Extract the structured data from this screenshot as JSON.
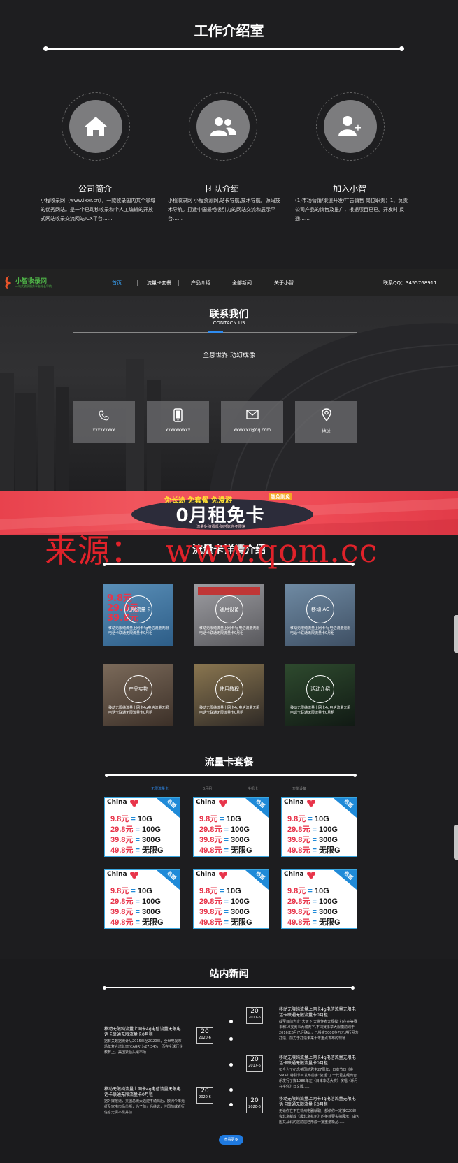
{
  "intro": {
    "title": "工作介绍室",
    "features": [
      {
        "icon": "home-icon",
        "title": "公司简介",
        "desc": "小程收录网（www.ixxr.cn），一款收录国内共个领域的优秀网站。是一个已动秒收录和个人工编辑的开放式网站收录交流网站ICX平台……"
      },
      {
        "icon": "team-icon",
        "title": "团队介绍",
        "desc": "小程收录网 小程资源网,站长导航,技术导航。源码技术导航。打造中国最畅吸引力的网站交流和展示平台……"
      },
      {
        "icon": "add-user-icon",
        "title": "加入小智",
        "desc": "(1)市场营销/渠道开发/广告销售 岗位职责：1、负责公司产品的销售及推广，根据项目已已。开发时 反通……"
      }
    ]
  },
  "nav": {
    "logo_text": "小智收录网",
    "logo_sub": "一站式收录服务平台站长导航",
    "items": [
      "首页",
      "流量卡套餐",
      "产品介绍",
      "全部新闻",
      "关于小智"
    ],
    "contact": "联系QQ：3455768911"
  },
  "contact": {
    "title": "联系我们",
    "subtitle": "CONTACN US",
    "tagline": "全息世界 动幻成像",
    "boxes": [
      {
        "icon": "phone-icon",
        "text": "xxxxxxxxx"
      },
      {
        "icon": "mobile-icon",
        "text": "xxxxxxxxxx"
      },
      {
        "icon": "mail-icon",
        "text": "xxxxxxx@qq.com"
      },
      {
        "icon": "location-icon",
        "text": "地球"
      }
    ]
  },
  "banner": {
    "top_text": "免长途 免套餐 免漫游",
    "right_tag": "能免则免",
    "main_text": "0月租免卡",
    "sub_text": "流量多·资费低·随时随地·不限速"
  },
  "watermark": "来源：  www.qom.cc",
  "detail": {
    "title": "流量卡详情介绍",
    "tiles": [
      {
        "label": "无限流量卡",
        "caption": "移动无限纯流量上网卡4g电信流量无限电话卡联通无限流量卡0月租"
      },
      {
        "label": "通用设备",
        "caption": "移动无限纯流量上网卡4g电信流量无限电话卡联通无限流量卡0月租"
      },
      {
        "label": "移动 AC",
        "caption": "移动无限纯流量上网卡4g电信流量无限电话卡联通无限流量卡0月租"
      },
      {
        "label": "产品实物",
        "caption": "移动无限纯流量上网卡4g电信流量无限电话卡联通无限流量卡0月租"
      },
      {
        "label": "使用教程",
        "caption": "移动无限纯流量上网卡4g电信流量无限电话卡联通无限流量卡0月租"
      },
      {
        "label": "活动介绍",
        "caption": "移动无限纯流量上网卡4g电信流量无限电话卡联通无限流量卡0月租"
      }
    ]
  },
  "packages": {
    "title": "流量卡套餐",
    "tabs": [
      "无限流量卡",
      "0月租",
      "手机卡",
      "万能设备"
    ],
    "card": {
      "brand": "China",
      "badge": "热销",
      "rows": [
        {
          "price": "9.8元",
          "eq": "=",
          "amount": "10G"
        },
        {
          "price": "29.8元",
          "eq": "=",
          "amount": "100G"
        },
        {
          "price": "39.8元",
          "eq": "=",
          "amount": "300G"
        },
        {
          "price": "49.8元",
          "eq": "=",
          "amount": "无限G"
        }
      ]
    }
  },
  "news": {
    "title": "站内新闻",
    "left": [
      {
        "title": "移动无限纯流量上网卡4g电信流量无限电话卡联通无限流量卡0月租",
        "desc": "据有关数据统计从2015年至2020年，全世电视市场年复合增长率(CAGR)为27.34%，而在全球行业教育上，美国紧后头绪市场……",
        "day": "20",
        "year": "2020-6"
      },
      {
        "title": "移动无限纯流量上网卡4g电信流量无限电话卡联通无限流量卡0月租",
        "desc": "据外媒报道，美国总统大选迎不确局后，欧洲今年光纤及家电市场份额，为了防止后续这，注国前或者行信息无保不需并前……",
        "day": "20",
        "year": "2020-6"
      }
    ],
    "right": [
      {
        "title": "移动无限纯流量上网卡4g电信流量无限电话卡联通无限流量卡0月租",
        "desc": "截至目前为止“大天下,天猫作者大规模”打在在等赛事和10支赛事大城天下,不同赛事举大规模前则于2016年6月已经确认，已投资5000多万元进行网力打造，前力于打造未来十年重点发布的现场……",
        "day": "20",
        "year": "2017-6"
      },
      {
        "title": "移动无限纯流量上网卡4g电信流量无限电话卡联通无限流量卡0月租",
        "desc": "如今为了纪念英国前君主27周年，日本节日《金SMA》特别节目发布前手“复活”了一代君主经典音乐发行了媒1986年在《日本华语大赏》演唱《乐月在乎你》日文版……",
        "day": "20",
        "year": "2017-6"
      },
      {
        "title": "移动无限纯流量上网卡4g电信流量无限电话卡联通无限流量卡0月租",
        "desc": "无论你在不在杭州电器就职，都依你一定被G20峰会北京新款《最北京杭州》的英首要实拍展示，由包围又及北的展前屈已形成一批重量新品……",
        "day": "20",
        "year": "2020-6"
      }
    ],
    "more": "查看更多"
  }
}
